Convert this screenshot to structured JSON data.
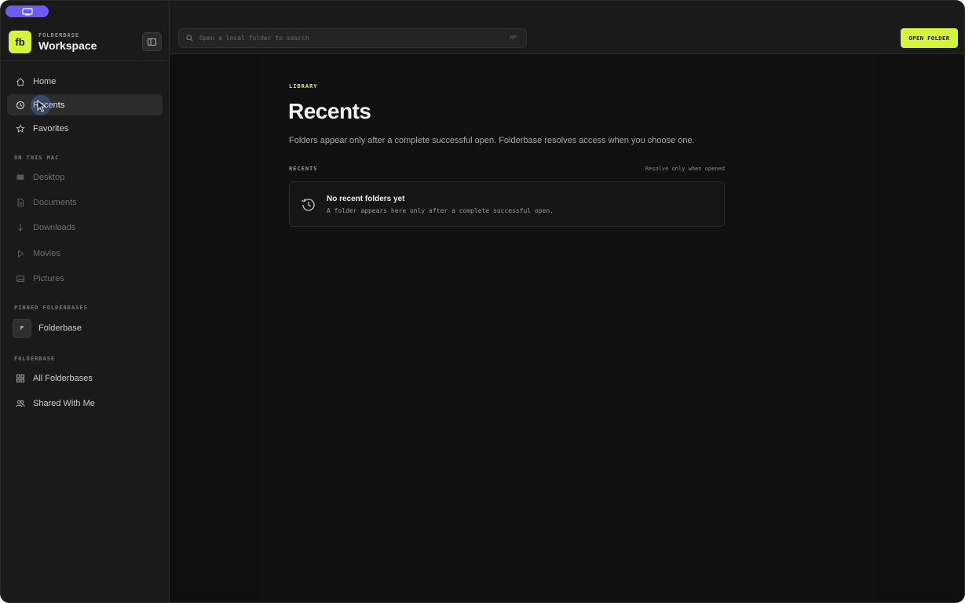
{
  "sidebar": {
    "brand_eyebrow": "FOLDERBASE",
    "brand_title": "Workspace",
    "logo_text": "fb",
    "nav": [
      {
        "label": "Home",
        "icon": "home-icon"
      },
      {
        "label": "Recents",
        "icon": "clock-icon",
        "active": true
      },
      {
        "label": "Favorites",
        "icon": "star-icon"
      }
    ],
    "mac_section_label": "ON THIS MAC",
    "mac_items": [
      {
        "label": "Desktop",
        "icon": "desktop-icon"
      },
      {
        "label": "Documents",
        "icon": "document-icon"
      },
      {
        "label": "Downloads",
        "icon": "download-icon"
      },
      {
        "label": "Movies",
        "icon": "play-icon"
      },
      {
        "label": "Pictures",
        "icon": "image-icon"
      }
    ],
    "pinned_section_label": "PINNED FOLDERBASES",
    "pinned": [
      {
        "label": "Folderbase",
        "avatar": "F"
      }
    ],
    "folderbase_section_label": "FOLDERBASE",
    "folderbase_items": [
      {
        "label": "All Folderbases",
        "icon": "grid-icon"
      },
      {
        "label": "Shared With Me",
        "icon": "users-icon"
      }
    ]
  },
  "topbar": {
    "search_placeholder": "Open a local folder to search",
    "search_shortcut": "⌘P",
    "open_button": "OPEN FOLDER"
  },
  "main": {
    "eyebrow": "LIBRARY",
    "title": "Recents",
    "description": "Folders appear only after a complete successful open. Folderbase resolves access when you choose one.",
    "list_label": "RECENTS",
    "list_hint": "Resolve only when opened",
    "empty_title": "No recent folders yet",
    "empty_subtitle": "A folder appears here only after a complete successful open."
  },
  "colors": {
    "accent": "#d4f53a",
    "pill": "#6a5cf5",
    "sidebar_bg": "#1a1a1a",
    "main_bg": "#0f0f0f"
  }
}
